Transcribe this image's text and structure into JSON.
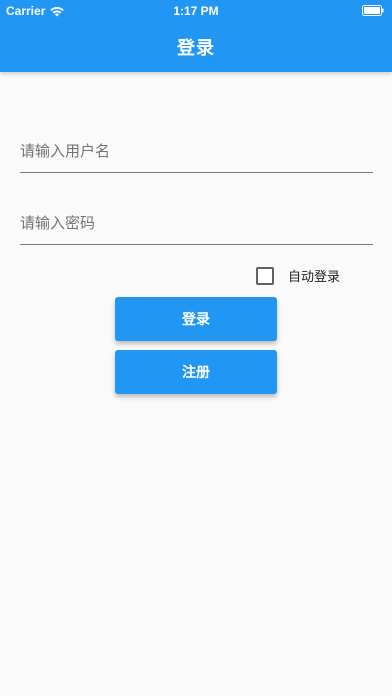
{
  "status_bar": {
    "carrier": "Carrier",
    "time": "1:17 PM",
    "icons": [
      "wifi-icon",
      "battery-icon"
    ]
  },
  "appbar": {
    "title": "登录",
    "color": "#2196f3"
  },
  "form": {
    "username_placeholder": "请输入用户名",
    "username_value": "",
    "password_placeholder": "请输入密码",
    "password_value": "",
    "auto_login_label": "自动登录",
    "auto_login_checked": false
  },
  "buttons": {
    "login_label": "登录",
    "register_label": "注册"
  }
}
